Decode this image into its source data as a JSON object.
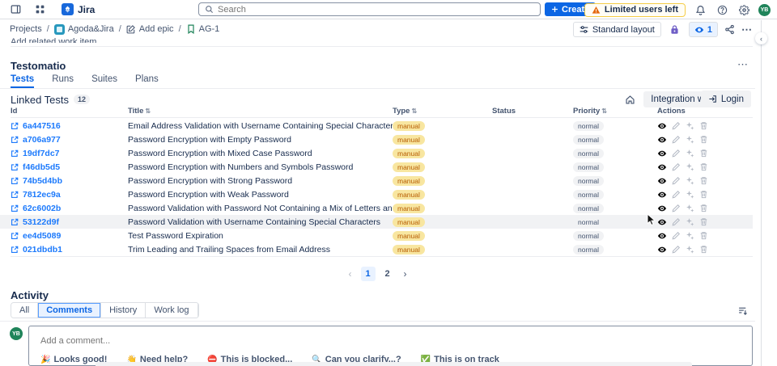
{
  "topbar": {
    "app_name": "Jira",
    "search_placeholder": "Search",
    "create_label": "Create",
    "warning_label": "Limited users left",
    "avatar_initials": "YB"
  },
  "breadcrumb": {
    "projects": "Projects",
    "project": "Agoda&Jira",
    "add_epic": "Add epic",
    "issue": "AG-1"
  },
  "toolbar": {
    "standard_layout_label": "Standard layout",
    "watchers_count": "1"
  },
  "clipped_text": "Add related work item",
  "panel": {
    "title": "Testomatio",
    "tabs": [
      {
        "label": "Tests",
        "active": true
      },
      {
        "label": "Runs"
      },
      {
        "label": "Suites"
      },
      {
        "label": "Plans"
      }
    ],
    "linked_tests_label": "Linked Tests",
    "linked_tests_count": "12",
    "integration_label": "Integration with Jira",
    "login_label": "Login"
  },
  "table": {
    "headers": [
      {
        "label": "Id"
      },
      {
        "label": "Title",
        "sort": "⇅"
      },
      {
        "label": "Type",
        "sort": "⇅"
      },
      {
        "label": "Status"
      },
      {
        "label": "Priority",
        "sort": "⇅"
      },
      {
        "label": "Actions"
      }
    ],
    "rows": [
      {
        "id": "6a447516",
        "title": "Email Address Validation with Username Containing Special Characters",
        "type": "manual",
        "priority": "normal"
      },
      {
        "id": "a706a977",
        "title": "Password Encryption with Empty Password",
        "type": "manual",
        "priority": "normal"
      },
      {
        "id": "19df7dc7",
        "title": "Password Encryption with Mixed Case Password",
        "type": "manual",
        "priority": "normal"
      },
      {
        "id": "f46db5d5",
        "title": "Password Encryption with Numbers and Symbols Password",
        "type": "manual",
        "priority": "normal"
      },
      {
        "id": "74b5d4bb",
        "title": "Password Encryption with Strong Password",
        "type": "manual",
        "priority": "normal"
      },
      {
        "id": "7812ec9a",
        "title": "Password Encryption with Weak Password",
        "type": "manual",
        "priority": "normal"
      },
      {
        "id": "62c6002b",
        "title": "Password Validation with Password Not Containing a Mix of Letters and Numbers",
        "type": "manual",
        "priority": "normal"
      },
      {
        "id": "53122d9f",
        "title": "Password Validation with Username Containing Special Characters",
        "type": "manual",
        "priority": "normal",
        "active": true
      },
      {
        "id": "ee4d5089",
        "title": "Test Password Expiration",
        "type": "manual",
        "priority": "normal"
      },
      {
        "id": "021dbdb1",
        "title": "Trim Leading and Trailing Spaces from Email Address",
        "type": "manual",
        "priority": "normal"
      }
    ]
  },
  "pagination": {
    "pages": [
      {
        "label": "1",
        "active": true
      },
      {
        "label": "2"
      }
    ]
  },
  "activity": {
    "title": "Activity",
    "tabs": [
      {
        "label": "All"
      },
      {
        "label": "Comments",
        "active": true
      },
      {
        "label": "History"
      },
      {
        "label": "Work log"
      }
    ]
  },
  "comment": {
    "avatar_initials": "YB",
    "placeholder": "Add a comment...",
    "quick_replies": [
      {
        "emoji": "🎉",
        "label": "Looks good!"
      },
      {
        "emoji": "👋",
        "label": "Need help?"
      },
      {
        "emoji": "⛔",
        "label": "This is blocked..."
      },
      {
        "emoji": "🔍",
        "label": "Can you clarify...?"
      },
      {
        "emoji": "✅",
        "label": "This is on track"
      }
    ]
  },
  "colors": {
    "accent_blue": "#0C66E4",
    "link_blue": "#1D7AFC",
    "status_green": "#4BCE97",
    "type_badge_bg": "#F8E6A0",
    "type_badge_text": "#B65C02",
    "priority_badge_bg": "#F1F2F4",
    "lock_purple": "#6E5DC6",
    "warning_border": "#F5CD47",
    "avatar_green": "#1F845A"
  }
}
